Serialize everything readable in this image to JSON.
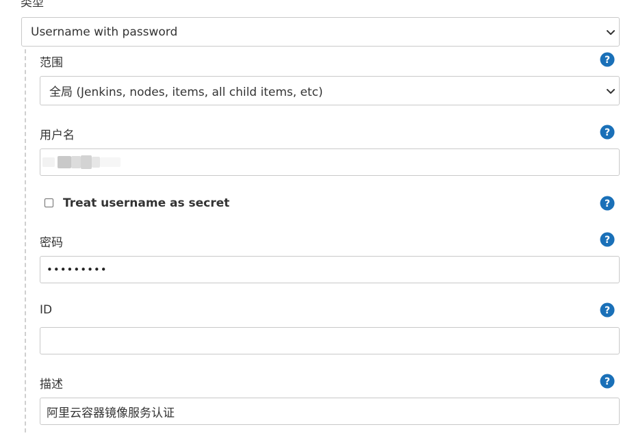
{
  "type_field": {
    "label": "类型",
    "selected": "Username with password"
  },
  "scope_field": {
    "label": "范围",
    "selected": "全局 (Jenkins, nodes, items, all child items, etc)"
  },
  "username_field": {
    "label": "用户名",
    "value": ""
  },
  "treat_secret": {
    "label": "Treat username as secret",
    "checked": false
  },
  "password_field": {
    "label": "密码",
    "masked_value": "•••••••••"
  },
  "id_field": {
    "label": "ID",
    "value": ""
  },
  "description_field": {
    "label": "描述",
    "value": "阿里云容器镜像服务认证"
  },
  "colors": {
    "help_icon": "#1a70b8",
    "border": "#c8c8c8",
    "text": "#333333"
  },
  "icons": {
    "help": "help-circle-icon",
    "dropdown": "chevron-down-icon"
  }
}
